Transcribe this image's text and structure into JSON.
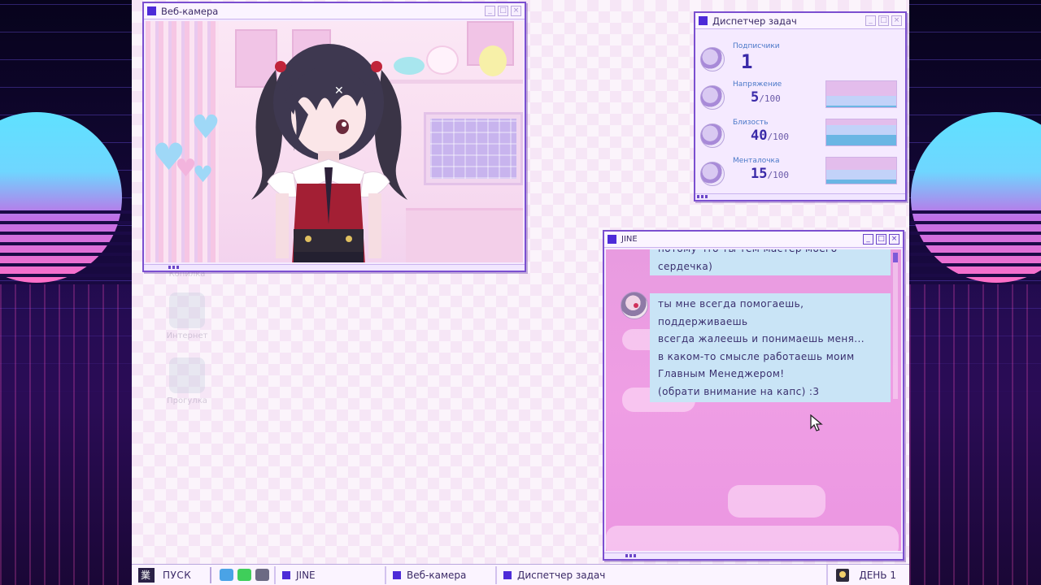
{
  "webcam": {
    "title": "Веб-камера"
  },
  "desktop_icons": [
    {
      "label": "Копилка"
    },
    {
      "label": "Интернет"
    },
    {
      "label": "Прогулка"
    }
  ],
  "taskmgr": {
    "title": "Диспетчер задач",
    "stats": [
      {
        "label": "Подписчики",
        "value": "1",
        "max": ""
      },
      {
        "label": "Напряжение",
        "value": "5",
        "max": "/100",
        "fraction": 0.05
      },
      {
        "label": "Близость",
        "value": "40",
        "max": "/100",
        "fraction": 0.4
      },
      {
        "label": "Менталочка",
        "value": "15",
        "max": "/100",
        "fraction": 0.15
      }
    ]
  },
  "chat": {
    "title": "JINE",
    "prev_message": [
      "потому что ты тем мастер моего",
      "сердечка)"
    ],
    "message": [
      "ты мне всегда помогаешь,",
      "поддерживаешь",
      "всегда жалеешь и понимаешь меня...",
      "в каком-то смысле работаешь моим",
      "Главным Менеджером!",
      "(обрати внимание на капс) :3"
    ]
  },
  "taskbar": {
    "start_label": "ПУСК",
    "items": [
      "JINE",
      "Веб-камера",
      "Диспетчер задач"
    ],
    "day_label": "ДЕНЬ 1"
  },
  "colors": {
    "accent": "#4d2bd8",
    "desktop_bg": "#f6e6f6",
    "chat_bg": "#ef9ee4",
    "bubble": "#c9e4f6",
    "bar_fill": "#6ab6e4"
  }
}
